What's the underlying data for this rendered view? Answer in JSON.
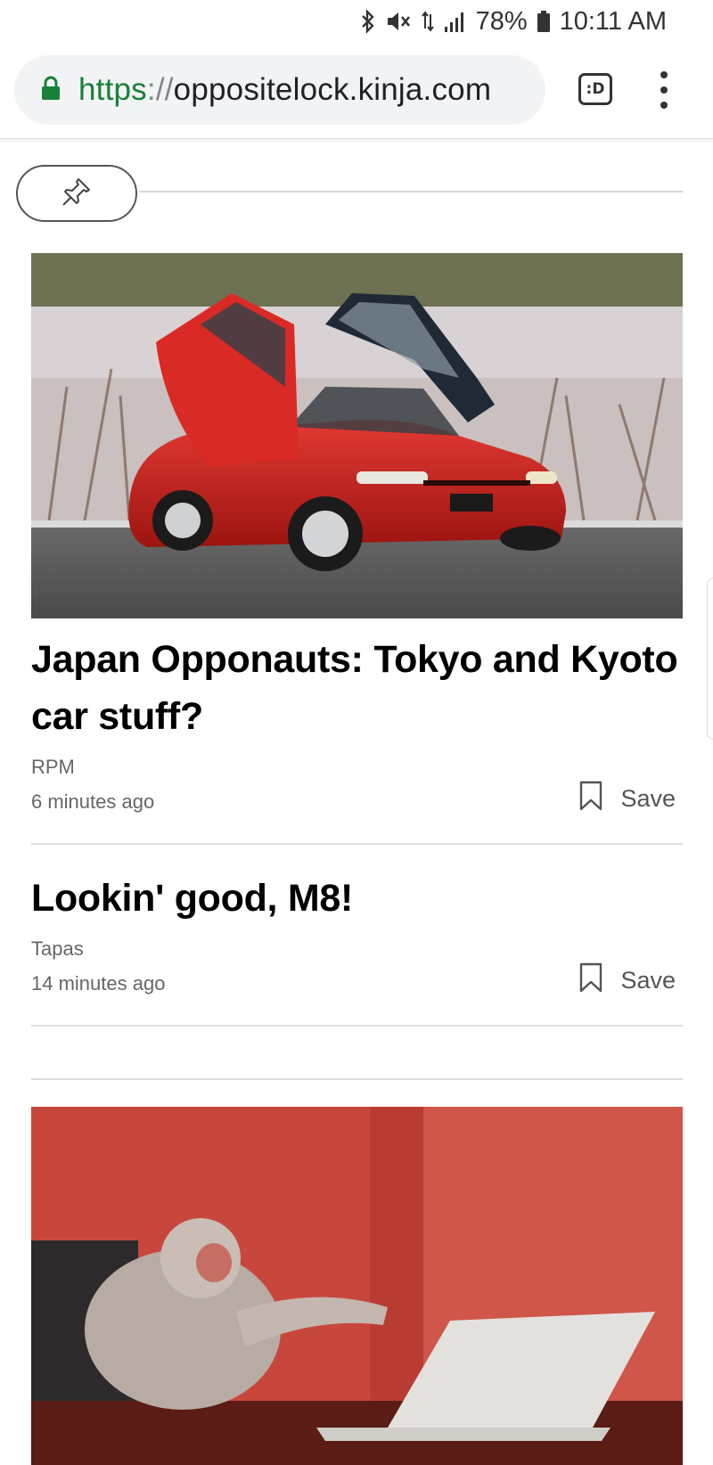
{
  "status_bar": {
    "battery": "78%",
    "time": "10:11 AM",
    "icons": [
      "bluetooth-icon",
      "mute-icon",
      "data-arrows-icon",
      "signal-icon",
      "battery-icon"
    ]
  },
  "browser": {
    "url_scheme": "https",
    "url_sep": "://",
    "url_host": "oppositelock.kinja.com",
    "tab_label": ":D",
    "secure_color": "#188038"
  },
  "feed": {
    "pin_icon": "pin-icon",
    "articles": [
      {
        "title": "Japan Opponauts: Tokyo and Kyoto car stuff?",
        "author": "RPM",
        "time": "6 minutes ago",
        "save_label": "Save",
        "image": "red-car-photo"
      },
      {
        "title": "Lookin' good, M8!",
        "author": "Tapas",
        "time": "14 minutes ago",
        "save_label": "Save"
      }
    ],
    "next_image": "monkey-laptop-photo"
  }
}
